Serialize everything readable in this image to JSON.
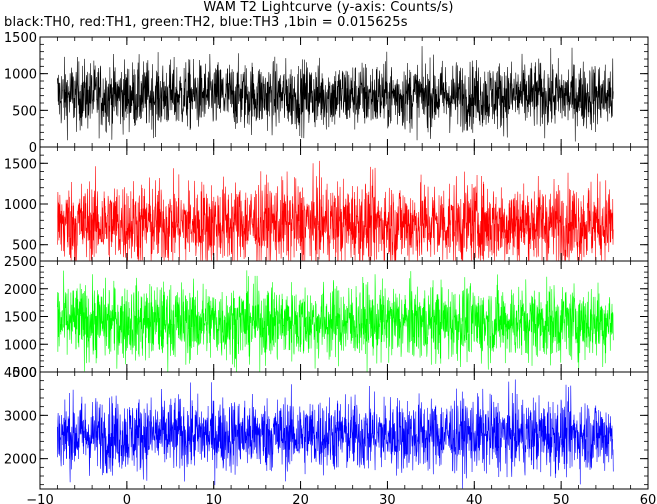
{
  "chart_data": {
    "type": "line",
    "title": "WAM T2 Lightcurve (y-axis: Counts/s)",
    "subtitle": "black:TH0, red:TH1, green:TH2, blue:TH3 ,1bin = 0.015625s",
    "xlim": [
      -10,
      60
    ],
    "x_ticks": [
      -10,
      0,
      10,
      20,
      30,
      40,
      50,
      60
    ],
    "x_tick_labels": [
      "−10",
      "0",
      "10",
      "20",
      "30",
      "40",
      "50",
      "60"
    ],
    "x_data_range": [
      -8,
      56
    ],
    "bin_width": 0.015625,
    "grid": false,
    "series": [
      {
        "name": "TH0",
        "color": "#000000",
        "ylim": [
          0,
          1500
        ],
        "y_ticks": [
          0,
          500,
          1000,
          1500
        ],
        "y_tick_labels": [
          "0",
          "500",
          "1000",
          "1500"
        ],
        "mean": 700,
        "spread": 420
      },
      {
        "name": "TH1",
        "color": "#ff0000",
        "ylim": [
          300,
          1700
        ],
        "y_ticks": [
          500,
          1000,
          1500
        ],
        "y_tick_labels": [
          "500",
          "1000",
          "1500"
        ],
        "mean": 760,
        "spread": 470
      },
      {
        "name": "TH2",
        "color": "#00ff00",
        "ylim": [
          500,
          2500
        ],
        "y_ticks": [
          500,
          1000,
          1500,
          2000,
          2500
        ],
        "y_tick_labels": [
          "500",
          "1000",
          "1500",
          "2000",
          "2500"
        ],
        "mean": 1400,
        "spread": 620
      },
      {
        "name": "TH3",
        "color": "#0000ff",
        "ylim": [
          1300,
          4000
        ],
        "y_ticks": [
          2000,
          3000,
          4000
        ],
        "y_tick_labels": [
          "2000",
          "3000",
          "4000"
        ],
        "mean": 2550,
        "spread": 780
      }
    ]
  }
}
